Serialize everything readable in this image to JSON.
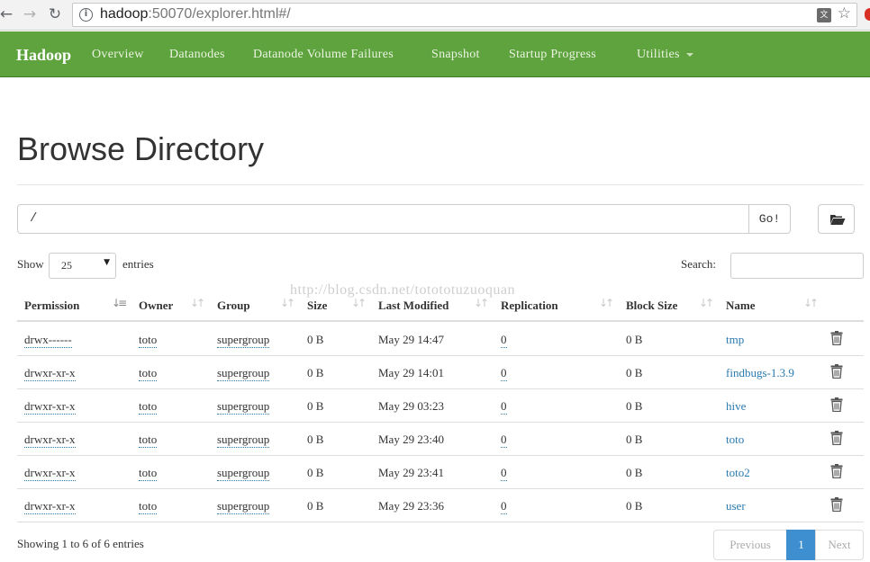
{
  "browser": {
    "url_host": "hadoop",
    "url_rest": ":50070/explorer.html#/"
  },
  "navbar": {
    "brand": "Hadoop",
    "items": [
      "Overview",
      "Datanodes",
      "Datanode Volume Failures",
      "Snapshot",
      "Startup Progress",
      "Utilities"
    ]
  },
  "page": {
    "title": "Browse Directory",
    "path_value": "/",
    "go_label": "Go!",
    "show_label": "Show",
    "page_length": "25",
    "entries_label": "entries",
    "search_label": "Search:",
    "search_value": "",
    "watermark": "http://blog.csdn.net/totototuzuoquan"
  },
  "table": {
    "columns": [
      "Permission",
      "Owner",
      "Group",
      "Size",
      "Last Modified",
      "Replication",
      "Block Size",
      "Name"
    ],
    "rows": [
      {
        "permission": "drwx------",
        "owner": "toto",
        "group": "supergroup",
        "size": "0 B",
        "modified": "May 29 14:47",
        "replication": "0",
        "block_size": "0 B",
        "name": "tmp"
      },
      {
        "permission": "drwxr-xr-x",
        "owner": "toto",
        "group": "supergroup",
        "size": "0 B",
        "modified": "May 29 14:01",
        "replication": "0",
        "block_size": "0 B",
        "name": "findbugs-1.3.9"
      },
      {
        "permission": "drwxr-xr-x",
        "owner": "toto",
        "group": "supergroup",
        "size": "0 B",
        "modified": "May 29 03:23",
        "replication": "0",
        "block_size": "0 B",
        "name": "hive"
      },
      {
        "permission": "drwxr-xr-x",
        "owner": "toto",
        "group": "supergroup",
        "size": "0 B",
        "modified": "May 29 23:40",
        "replication": "0",
        "block_size": "0 B",
        "name": "toto"
      },
      {
        "permission": "drwxr-xr-x",
        "owner": "toto",
        "group": "supergroup",
        "size": "0 B",
        "modified": "May 29 23:41",
        "replication": "0",
        "block_size": "0 B",
        "name": "toto2"
      },
      {
        "permission": "drwxr-xr-x",
        "owner": "toto",
        "group": "supergroup",
        "size": "0 B",
        "modified": "May 29 23:36",
        "replication": "0",
        "block_size": "0 B",
        "name": "user"
      }
    ]
  },
  "footer": {
    "info": "Showing 1 to 6 of 6 entries",
    "previous": "Previous",
    "current_page": "1",
    "next": "Next"
  },
  "colors": {
    "navbar": "#5fa33e",
    "link": "#2a7ab0",
    "active_page": "#3d8fd0"
  }
}
